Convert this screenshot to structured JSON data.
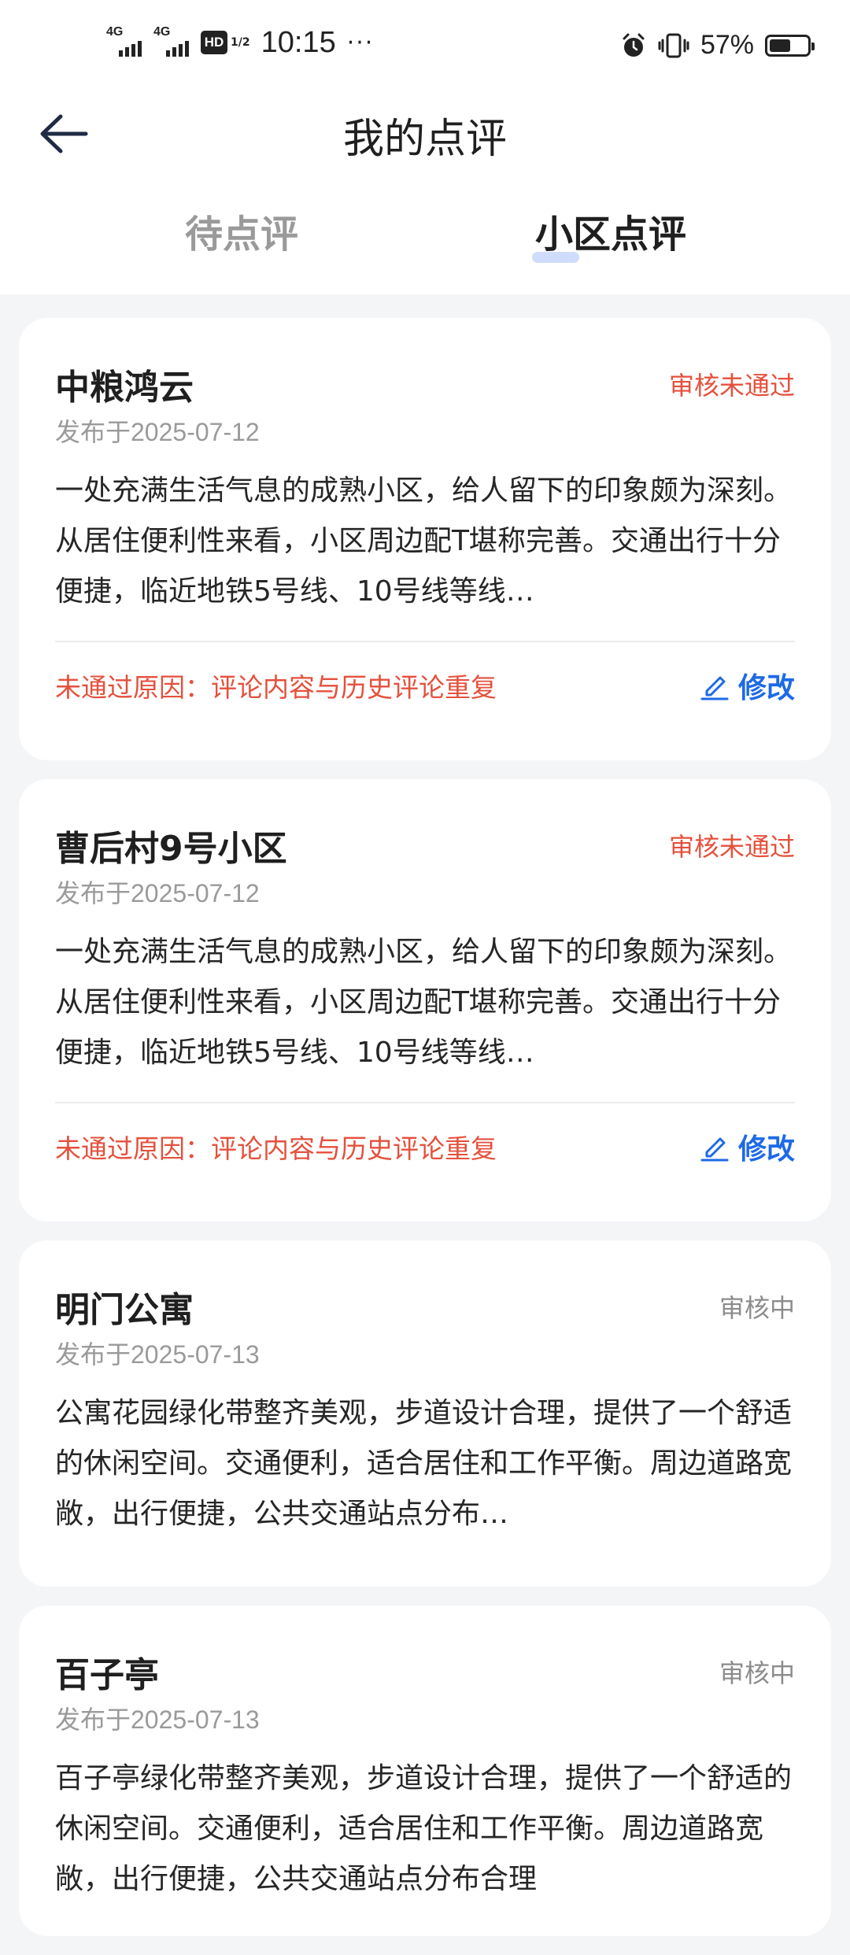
{
  "status_bar": {
    "signal1_label": "4G",
    "signal2_label": "4G",
    "hd_label": "HD",
    "hd_sub": "1/2",
    "time": "10:15",
    "more": "···",
    "battery_text": "57%",
    "battery_level": 0.57,
    "icons": [
      "alarm-icon",
      "vibrate-icon",
      "battery-icon"
    ]
  },
  "header": {
    "title": "我的点评",
    "back_icon": "arrow-left-icon"
  },
  "tabs": [
    {
      "label": "待点评",
      "active": false
    },
    {
      "label": "小区点评",
      "active": true
    }
  ],
  "colors": {
    "fail": "#e5503c",
    "pending": "#8c8c8c",
    "accent": "#1e6ae6",
    "tab_indicator": "#cfdcfb",
    "background": "#f4f5f7"
  },
  "reviews": [
    {
      "name": "中粮鸿云",
      "status": "审核未通过",
      "date": "发布于2025-07-12",
      "text": "一处充满生活气息的成熟小区，给人留下的印象颇为深刻。从居住便利性来看，小区周边配T堪称完善。交通出行十分便捷，临近地铁5号线、10号线等线…",
      "reason": "未通过原因：评论内容与历史评论重复",
      "edit_label": "修改"
    },
    {
      "name": "曹后村9号小区",
      "status": "审核未通过",
      "date": "发布于2025-07-12",
      "text": "一处充满生活气息的成熟小区，给人留下的印象颇为深刻。从居住便利性来看，小区周边配T堪称完善。交通出行十分便捷，临近地铁5号线、10号线等线…",
      "reason": "未通过原因：评论内容与历史评论重复",
      "edit_label": "修改"
    },
    {
      "name": "明门公寓",
      "status": "审核中",
      "date": "发布于2025-07-13",
      "text": "公寓花园绿化带整齐美观，步道设计合理，提供了一个舒适的休闲空间。交通便利，适合居住和工作平衡。周边道路宽敞，出行便捷，公共交通站点分布…"
    },
    {
      "name": "百子亭",
      "status": "审核中",
      "date": "发布于2025-07-13",
      "text": "百子亭绿化带整齐美观，步道设计合理，提供了一个舒适的休闲空间。交通便利，适合居住和工作平衡。周边道路宽敞，出行便捷，公共交通站点分布合理"
    }
  ]
}
